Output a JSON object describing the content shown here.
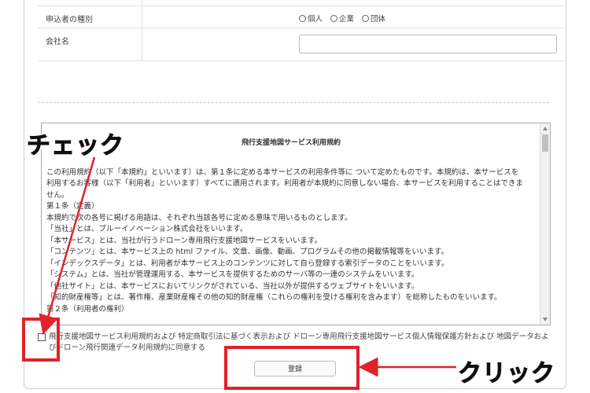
{
  "form": {
    "kind_label": "申込者の種別",
    "kind_options": [
      "個人",
      "企業",
      "団体"
    ],
    "company_label": "会社名",
    "company_value": ""
  },
  "terms": {
    "title": "飛行支援地図サービス利用規約",
    "lines": [
      "この利用規約（以下「本規約」といいます）は、第１条に定める本サービスの利用条件等に ついて定めたものです。本規約は、本サービスを",
      "利用するお客様（以下「利用者」といいます）すべてに適用されます。利用者が本規約に同意しない場合、本サービスを利用することはできま",
      "せん。",
      "第１条（定義）",
      "本規約で次の各号に掲げる用語は、それぞれ当該各号に定める意味で用いるものとします。",
      "「当社」とは、ブルーイノベーション株式会社をいいます。",
      "「本サービス」とは、当社が行うドローン専用飛行支援地図サービスをいいます。",
      "「コンテンツ」とは、本サービス上の html ファイル、文章、画像、動画、プログラムその他の掲載情報等をいいます。",
      "「インデックスデータ」とは、利用者が本サービス上のコンテンツに対して自ら登録する索引データのことをいいます。",
      "「システム」とは、当社が管理運用する、本サービスを提供するためのサーバ等の一連のシステムをいいます。",
      "「他社サイト」とは、本サービスにおいてリンクがされている、当社以外が提供するウェブサイトをいいます。",
      "「知的財産権等」とは、著作権、産業財産権その他の知的財産権（これらの権利を受ける権利を含みます）を総称したものをいいます。",
      "第２条（利用者の権利）"
    ]
  },
  "agreement": {
    "text": "飛行支援地図サービス利用規約および 特定商取引法に基づく表示および ドローン専用飛行支援地図サービス個人情報保護方針および 地図データおよびドローン飛行関連データ利用規約に同意する"
  },
  "submit": {
    "label": "登録"
  },
  "annotations": {
    "check_label": "チェック",
    "click_label": "クリック",
    "highlight_color": "#e0222a"
  }
}
